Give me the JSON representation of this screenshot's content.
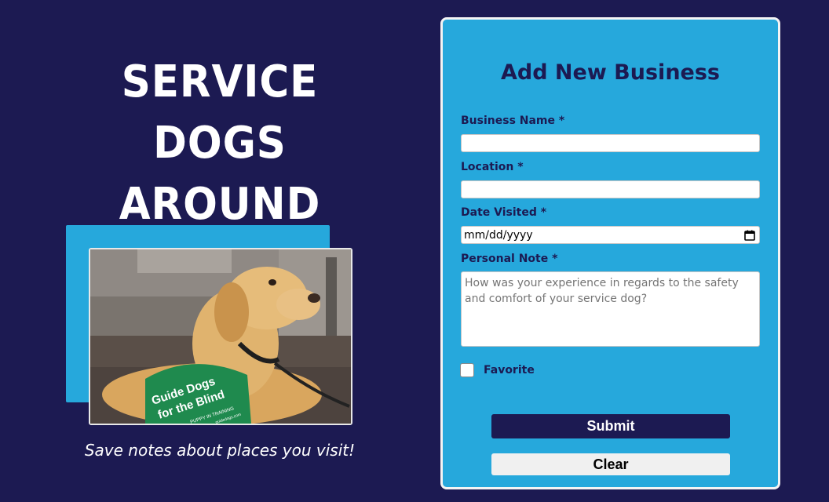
{
  "hero": {
    "title_line1": "SERVICE DOGS",
    "title_line2": "AROUND TOWN",
    "tagline": "Save notes about places you visit!",
    "photo": {
      "vest_text_line1": "Guide Dogs",
      "vest_text_line2": "for the Blind",
      "vest_text_line3": "PUPPY IN TRAINING",
      "vest_text_line4": "guidedogs.com"
    }
  },
  "form": {
    "title": "Add New Business",
    "business_name": {
      "label": "Business Name *",
      "value": ""
    },
    "location": {
      "label": "Location *",
      "value": ""
    },
    "date_visited": {
      "label": "Date Visited *",
      "placeholder": "mm/dd/yyyy"
    },
    "personal_note": {
      "label": "Personal Note *",
      "placeholder": "How was your experience in regards to the safety and comfort of your service dog?"
    },
    "favorite": {
      "label": "Favorite",
      "checked": false
    },
    "submit_label": "Submit",
    "clear_label": "Clear"
  },
  "colors": {
    "background": "#1c1a52",
    "accent": "#26a8dc",
    "card_border": "#f4f4f4"
  }
}
